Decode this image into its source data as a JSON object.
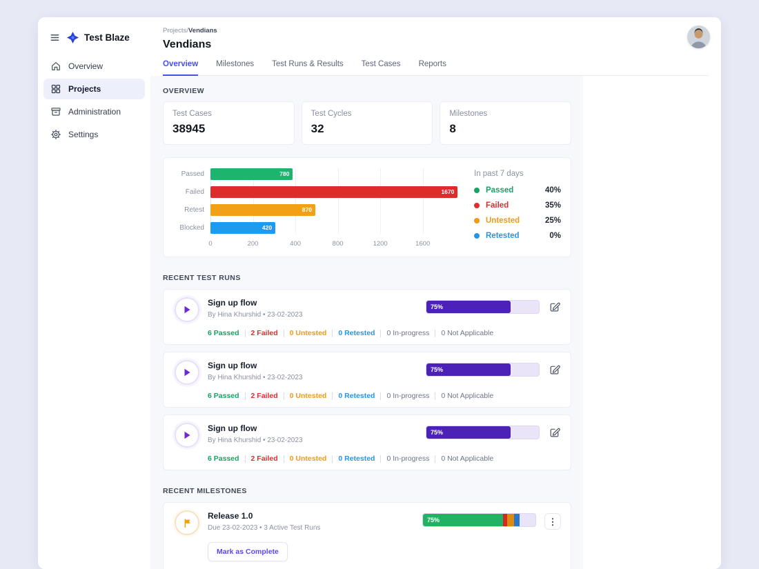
{
  "colors": {
    "page_bg": "#e7e9f5",
    "content_bg": "#f7f8fb",
    "accent_indigo": "#4450e6",
    "progress_purple": "#4b21b8",
    "green": "#18a264",
    "red": "#e12d2d",
    "orange": "#f29a16",
    "blue": "#2496e8"
  },
  "sidebar": {
    "logo_text": "Test Blaze",
    "items": [
      {
        "label": "Overview",
        "icon": "home-icon"
      },
      {
        "label": "Projects",
        "icon": "grid-icon"
      },
      {
        "label": "Administration",
        "icon": "archive-icon"
      },
      {
        "label": "Settings",
        "icon": "gear-icon"
      }
    ]
  },
  "header": {
    "breadcrumb_path": "Projects/",
    "breadcrumb_current": "Vendians",
    "title": "Vendians",
    "tabs": [
      {
        "label": "Overview"
      },
      {
        "label": "Milestones"
      },
      {
        "label": "Test Runs & Results"
      },
      {
        "label": "Test Cases"
      },
      {
        "label": "Reports"
      }
    ]
  },
  "overview": {
    "section_label": "OVERVIEW",
    "stats": [
      {
        "label": "Test Cases",
        "value": "38945"
      },
      {
        "label": "Test Cycles",
        "value": "32"
      },
      {
        "label": "Milestones",
        "value": "8"
      }
    ]
  },
  "chart_data": {
    "type": "bar",
    "orientation": "horizontal",
    "categories": [
      "Passed",
      "Failed",
      "Retest",
      "Blocked"
    ],
    "values": [
      780,
      1670,
      870,
      420
    ],
    "bar_colors": [
      "#1db46e",
      "#e02b2b",
      "#f2a015",
      "#1e9bec"
    ],
    "bar_widths_pct": [
      33,
      99,
      42,
      26
    ],
    "x_ticks": [
      "0",
      "200",
      "400",
      "800",
      "1200",
      "1600"
    ],
    "grid": true,
    "legend_position": "right",
    "legend_title": "In past 7 days",
    "legend": [
      {
        "label": "Passed",
        "pct": "40%",
        "color": "#18a264"
      },
      {
        "label": "Failed",
        "pct": "35%",
        "color": "#e12d2d"
      },
      {
        "label": "Untested",
        "pct": "25%",
        "color": "#f29a16"
      },
      {
        "label": "Retested",
        "pct": "0%",
        "color": "#2496e8"
      }
    ]
  },
  "recent_test_runs": {
    "section_label": "RECENT TEST RUNS",
    "runs": [
      {
        "title": "Sign up flow",
        "meta": "By Hina Khurshid • 23-02-2023",
        "progress_label": "75%",
        "progress_pct": 75,
        "stats": [
          "6 Passed",
          "2 Failed",
          "0 Untested",
          "0 Retested",
          "0 In-progress",
          "0 Not Applicable"
        ]
      },
      {
        "title": "Sign up flow",
        "meta": "By Hina Khurshid • 23-02-2023",
        "progress_label": "75%",
        "progress_pct": 75,
        "stats": [
          "6 Passed",
          "2 Failed",
          "0 Untested",
          "0 Retested",
          "0 In-progress",
          "0 Not Applicable"
        ]
      },
      {
        "title": "Sign up flow",
        "meta": "By Hina Khurshid • 23-02-2023",
        "progress_label": "75%",
        "progress_pct": 75,
        "stats": [
          "6 Passed",
          "2 Failed",
          "0 Untested",
          "0 Retested",
          "0 In-progress",
          "0 Not Applicable"
        ]
      }
    ]
  },
  "recent_milestones": {
    "section_label": "RECENT MILESTONES",
    "milestones": [
      {
        "title": "Release 1.0",
        "meta": "Due 23-02-2023 • 3 Active Test Runs",
        "action_label": "Mark as Complete",
        "progress_label": "75%",
        "segments": {
          "green_pct": 71,
          "red_pct": 4,
          "orange_pct": 6,
          "blue_pct": 5
        }
      }
    ]
  }
}
